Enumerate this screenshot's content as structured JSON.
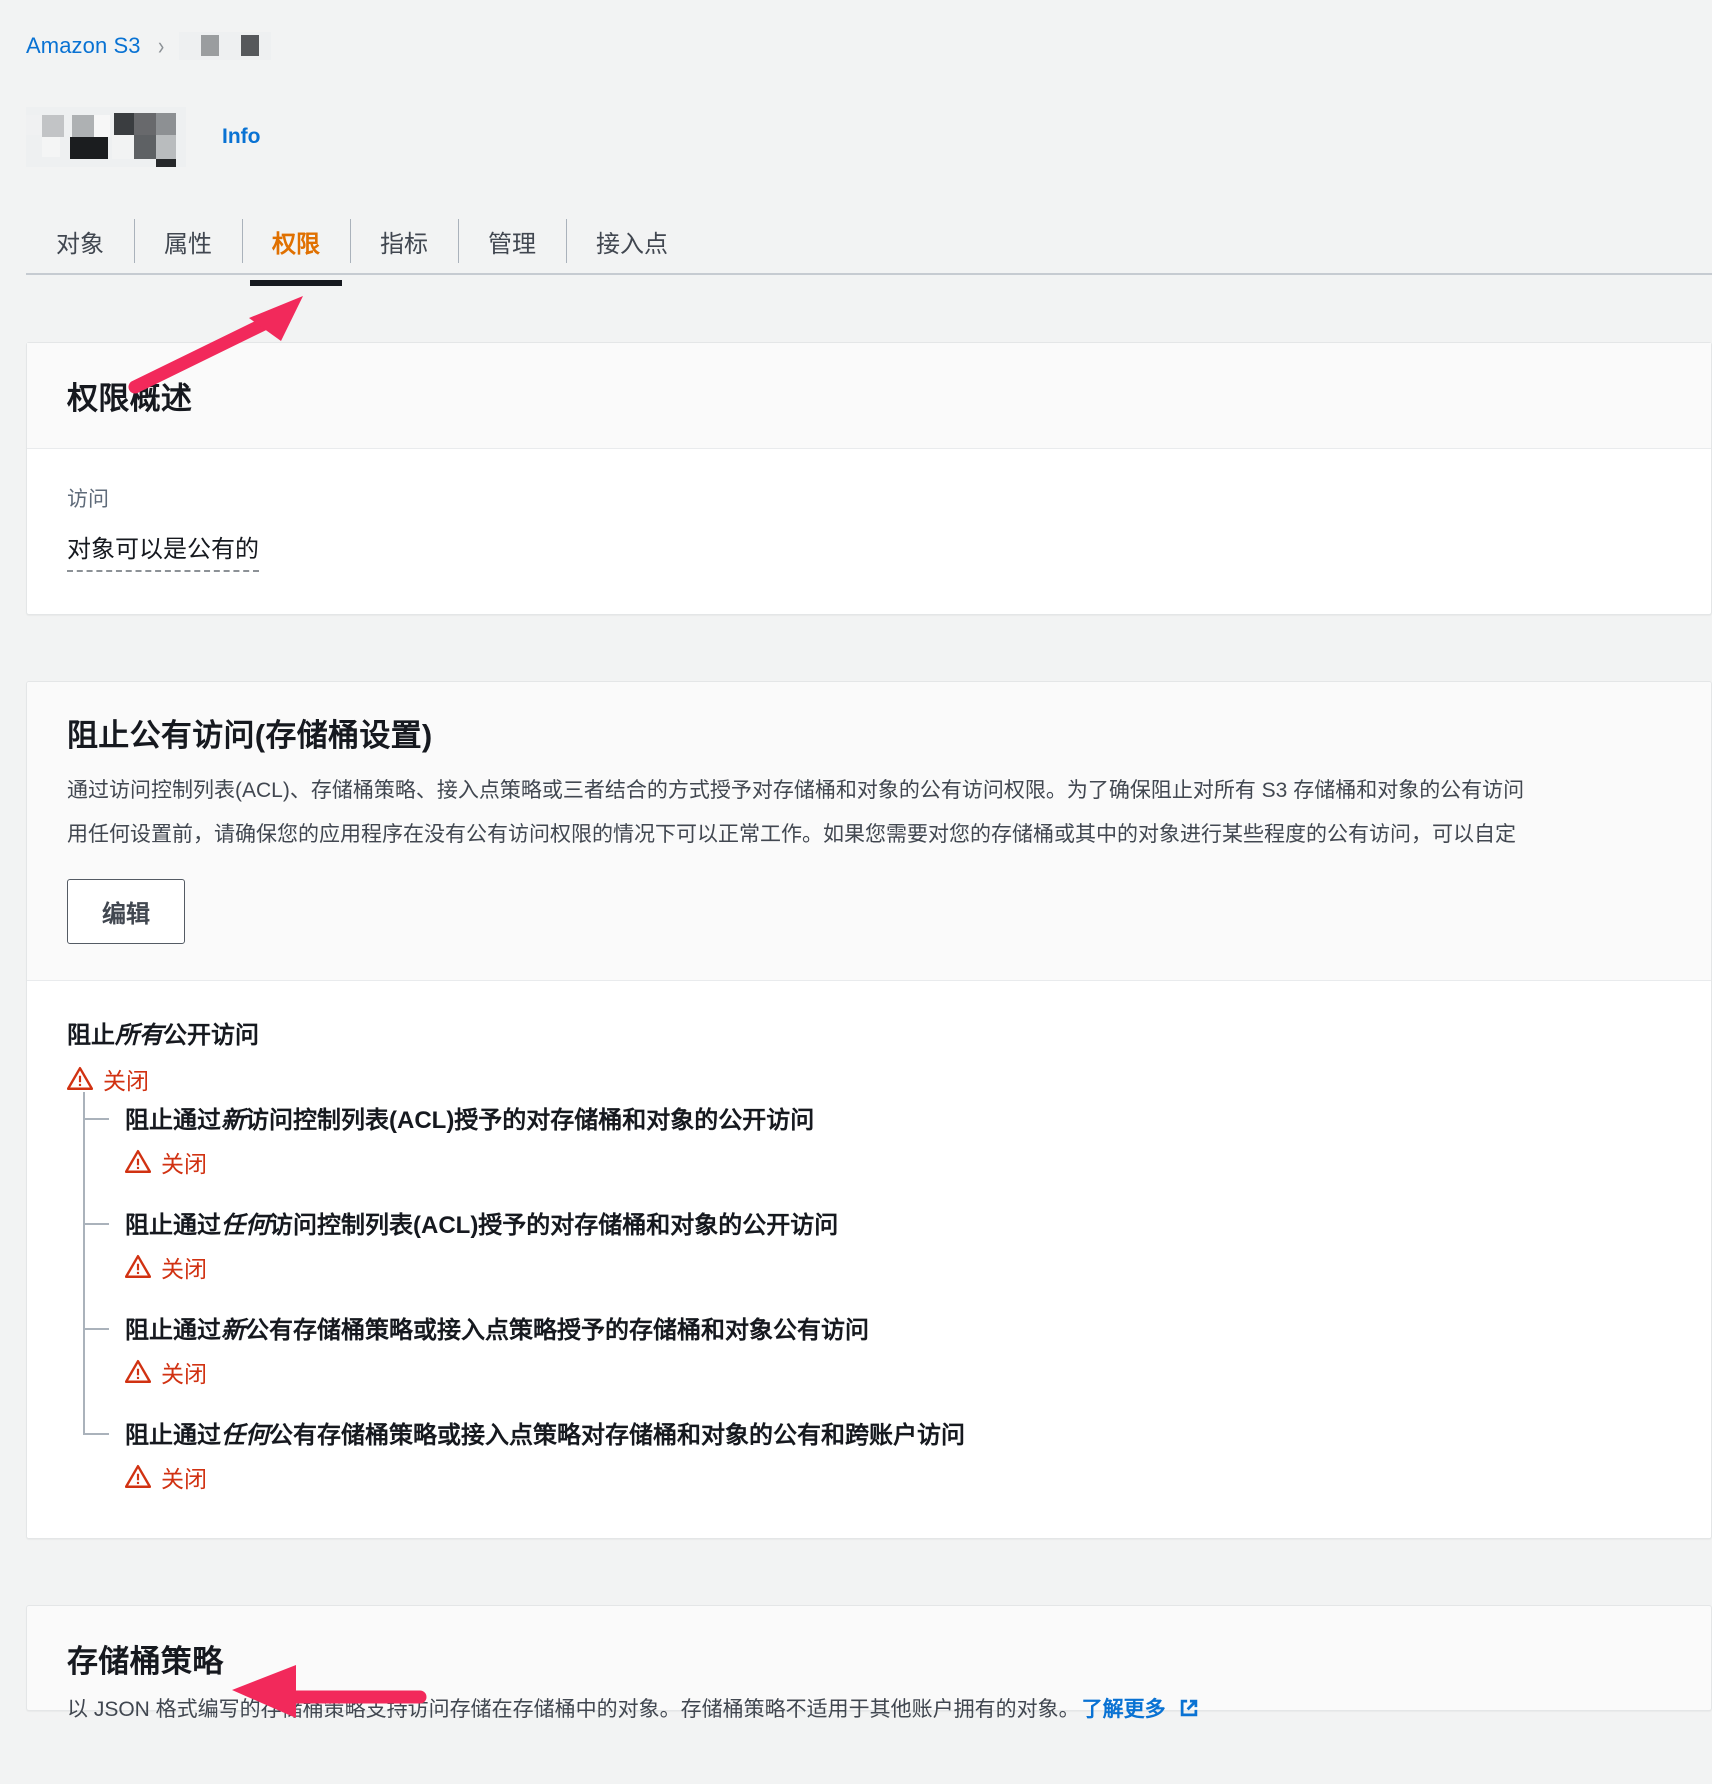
{
  "breadcrumb": {
    "root_label": "Amazon S3",
    "separator": "›",
    "current_redacted": true
  },
  "page_header": {
    "title_redacted": true,
    "info_label": "Info"
  },
  "tabs": [
    {
      "label": "对象",
      "active": false
    },
    {
      "label": "属性",
      "active": false
    },
    {
      "label": "权限",
      "active": true
    },
    {
      "label": "指标",
      "active": false
    },
    {
      "label": "管理",
      "active": false
    },
    {
      "label": "接入点",
      "active": false
    }
  ],
  "permissions_overview": {
    "title": "权限概述",
    "access_label": "访问",
    "access_value": "对象可以是公有的"
  },
  "block_public_access": {
    "title": "阻止公有访问(存储桶设置)",
    "description_line1": "通过访问控制列表(ACL)、存储桶策略、接入点策略或三者结合的方式授予对存储桶和对象的公有访问权限。为了确保阻止对所有 S3 存储桶和对象的公有访问",
    "description_line2": "用任何设置前，请确保您的应用程序在没有公有访问权限的情况下可以正常工作。如果您需要对您的存储桶或其中的对象进行某些程度的公有访问，可以自定",
    "edit_button": "编辑",
    "root": {
      "title_prefix": "阻止",
      "title_italic": "所有",
      "title_suffix": "公开访问",
      "status": "关闭"
    },
    "sub_settings": [
      {
        "prefix": "阻止通过",
        "italic": "新",
        "suffix": "访问控制列表(ACL)授予的对存储桶和对象的公开访问",
        "status": "关闭"
      },
      {
        "prefix": "阻止通过",
        "italic": "任何",
        "suffix": "访问控制列表(ACL)授予的对存储桶和对象的公开访问",
        "status": "关闭"
      },
      {
        "prefix": "阻止通过",
        "italic": "新",
        "suffix": "公有存储桶策略或接入点策略授予的存储桶和对象公有访问",
        "status": "关闭"
      },
      {
        "prefix": "阻止通过",
        "italic": "任何",
        "suffix": "公有存储桶策略或接入点策略对存储桶和对象的公有和跨账户访问",
        "status": "关闭"
      }
    ]
  },
  "bucket_policy": {
    "title": "存储桶策略",
    "description": "以 JSON 格式编写的存储桶策略支持访问存储在存储桶中的对象。存储桶策略不适用于其他账户拥有的对象。",
    "learn_more": "了解更多"
  },
  "colors": {
    "link": "#0972d3",
    "active_tab": "#e07000",
    "warning": "#d13212",
    "annotation_arrow": "#f2295b",
    "page_bg": "#f2f3f3"
  }
}
